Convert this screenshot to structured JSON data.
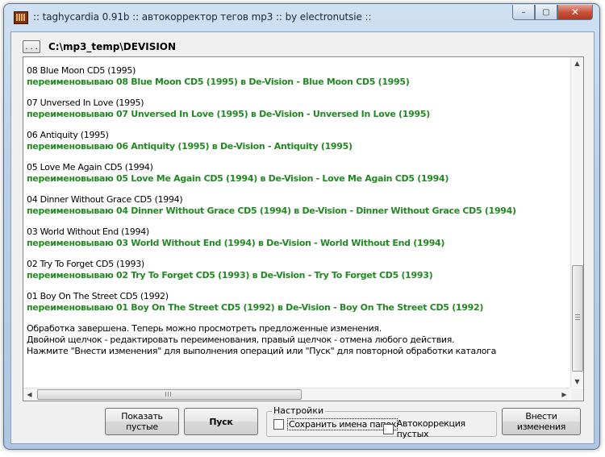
{
  "window": {
    "title": ":: taghycardia 0.91b :: автокорректор тегов mp3 :: by electronutsie ::",
    "minimize_glyph": "–",
    "maximize_glyph": "▢",
    "close_glyph": "✕"
  },
  "toolbar": {
    "browse_label": ". . .",
    "path": "C:\\mp3_temp\\DEVISION"
  },
  "log": {
    "entries": [
      {
        "original": "08 Blue Moon CD5 (1995)",
        "rename": "переименовываю 08 Blue Moon CD5 (1995) в De-Vision - Blue Moon CD5 (1995)"
      },
      {
        "original": "07 Unversed In Love (1995)",
        "rename": "переименовываю 07 Unversed In Love (1995) в De-Vision - Unversed In Love (1995)"
      },
      {
        "original": "06 Antiquity (1995)",
        "rename": "переименовываю 06 Antiquity (1995) в De-Vision - Antiquity (1995)"
      },
      {
        "original": "05 Love Me Again CD5 (1994)",
        "rename": "переименовываю 05 Love Me Again CD5 (1994) в De-Vision - Love Me Again CD5 (1994)"
      },
      {
        "original": "04 Dinner Without Grace CD5 (1994)",
        "rename": "переименовываю 04 Dinner Without Grace CD5 (1994) в De-Vision - Dinner Without Grace CD5 (1994)"
      },
      {
        "original": "03 World Without End (1994)",
        "rename": "переименовываю 03 World Without End (1994) в De-Vision - World Without End (1994)"
      },
      {
        "original": "02 Try To Forget CD5 (1993)",
        "rename": "переименовываю 02 Try To Forget CD5 (1993) в De-Vision - Try To Forget CD5 (1993)"
      },
      {
        "original": "01 Boy On The Street CD5 (1992)",
        "rename": "переименовываю 01 Boy On The Street CD5 (1992) в De-Vision - Boy On The Street CD5 (1992)"
      }
    ],
    "status_lines": [
      "Обработка завершена. Теперь можно просмотреть предложенные изменения.",
      "Двойной щелчок - редактировать переименования, правый щелчок - отмена любого действия.",
      "Нажмите \"Внести изменения\" для выполнения операций или \"Пуск\" для повторной обработки каталога"
    ]
  },
  "buttons": {
    "show_empty": "Показать пустые",
    "start": "Пуск",
    "apply": "Внести изменения"
  },
  "settings": {
    "title": "Настройки",
    "keep_folder_names": {
      "label": "Сохранить имена папок",
      "checked": false
    },
    "autocorrect_empty": {
      "label": "Автокоррекция пустых",
      "checked": false
    }
  },
  "colors": {
    "rename_text": "#1f8a1f"
  }
}
